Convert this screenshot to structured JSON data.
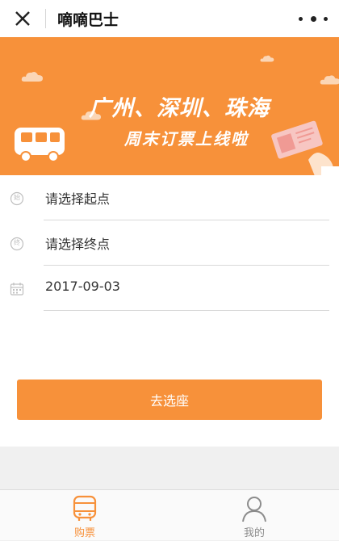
{
  "titlebar": {
    "title": "嘀嘀巴士"
  },
  "banner": {
    "title": "广州、深圳、珠海",
    "subtitle": "周末订票上线啦"
  },
  "form": {
    "origin": {
      "badge": "始",
      "placeholder": "请选择起点"
    },
    "destination": {
      "badge": "终",
      "placeholder": "请选择终点"
    },
    "date": {
      "value": "2017-09-03"
    },
    "submit_label": "去选座"
  },
  "tabs": [
    {
      "label": "购票",
      "active": true,
      "color": "#f7913a"
    },
    {
      "label": "我的",
      "active": false,
      "color": "#8c8c8c"
    }
  ],
  "colors": {
    "accent": "#f7913a"
  }
}
